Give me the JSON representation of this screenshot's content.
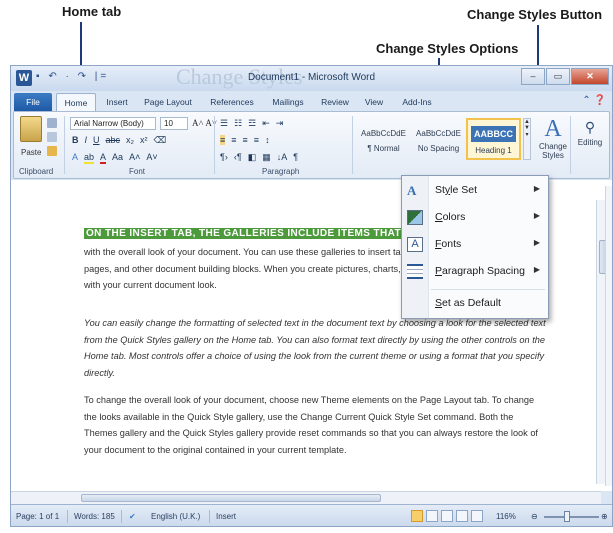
{
  "callouts": {
    "home_tab": "Home  tab",
    "change_styles_options": "Change Styles Options",
    "change_styles_button": "Change Styles Button"
  },
  "window": {
    "title": "Document1 - Microsoft Word",
    "bg_title": "Change Styles",
    "app_icon": "W",
    "qat": "▪ ↶ · ↷ |="
  },
  "tabs": [
    "File",
    "Home",
    "Insert",
    "Page Layout",
    "References",
    "Mailings",
    "Review",
    "View",
    "Add-Ins"
  ],
  "ribbon": {
    "clipboard": {
      "label": "Clipboard",
      "paste": "Paste"
    },
    "font": {
      "label": "Font",
      "name": "Arial Narrow (Body)",
      "size": "10"
    },
    "paragraph": {
      "label": "Paragraph"
    },
    "styles": {
      "items": [
        {
          "sample": "AaBbCcDdE",
          "name": "¶ Normal"
        },
        {
          "sample": "AaBbCcDdE",
          "name": "No Spacing"
        },
        {
          "sample": "AABBCC",
          "name": "Heading 1"
        }
      ],
      "change_styles": "Change Styles",
      "editing": "Editing"
    }
  },
  "document": {
    "heading": "ON THE INSERT TAB, THE GALLERIES INCLUDE ITEMS THAT AR",
    "paragraphs": [
      "with the overall look of your document. You can use these galleries to insert tables, headers, footers, lists, cover pages, and other document building blocks. When you create pictures, charts, or diagrams, they also coordinate with your current document look.",
      "You can easily change the formatting of selected text in the document text by choosing a look for the selected text from the Quick Styles gallery on the Home tab. You can also format text directly by using the other controls on the Home tab. Most controls offer a choice of using the look from the current theme or using a format that you specify directly.",
      "To change the overall look of your document, choose new Theme elements on the Page Layout tab. To change the looks available in the Quick Style gallery, use the Change Current Quick Style Set command. Both the Themes gallery and the Quick Styles gallery provide reset commands so that you can always restore the look of your document to the original contained in your current template."
    ]
  },
  "menu": {
    "items": [
      {
        "label": "Style Set",
        "underline": "y",
        "icon": "style-set-icon",
        "submenu": true
      },
      {
        "label": "Colors",
        "underline": "C",
        "icon": "colors-icon",
        "submenu": true
      },
      {
        "label": "Fonts",
        "underline": "F",
        "icon": "fonts-icon",
        "submenu": true
      },
      {
        "label": "Paragraph Spacing",
        "underline": "P",
        "icon": "paragraph-spacing-icon",
        "submenu": true
      },
      {
        "label": "Set as Default",
        "underline": "S",
        "icon": "",
        "submenu": false
      }
    ]
  },
  "statusbar": {
    "page": "Page: 1 of 1",
    "words": "Words: 185",
    "language": "English (U.K.)",
    "mode": "Insert",
    "zoom": "116%"
  },
  "colors": {
    "accent": "#2b5797",
    "heading_highlight": "#4d9a3c",
    "arrow": "#1f3a7a"
  }
}
